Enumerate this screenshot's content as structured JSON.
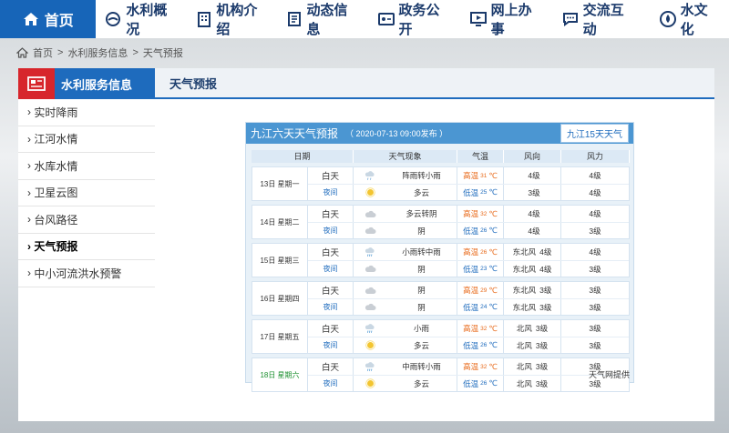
{
  "nav": {
    "home": "首页",
    "items": [
      "水利概况",
      "机构介绍",
      "动态信息",
      "政务公开",
      "网上办事",
      "交流互动",
      "水文化"
    ]
  },
  "breadcrumb": [
    "首页",
    ">",
    "水利服务信息",
    ">",
    "天气预报"
  ],
  "sidebar": {
    "title": "水利服务信息",
    "items": [
      "实时降雨",
      "江河水情",
      "水库水情",
      "卫星云图",
      "台风路径",
      "天气预报",
      "中小河流洪水预警"
    ],
    "active_index": 5
  },
  "content": {
    "tab": "天气预报"
  },
  "widget": {
    "title": "九江六天天气预报",
    "date": "（ 2020-07-13 09:00发布 ）",
    "button": "九江15天天气",
    "columns": [
      "日期",
      "天气现象",
      "气温",
      "风向",
      "风力"
    ],
    "days": [
      {
        "date": "13日 星期一",
        "day_desc": "阵雨转小雨",
        "day_hi_label": "高温",
        "day_temp": "31",
        "day_wind_dir": "",
        "day_wind_lvl": "4级",
        "day_force": "4级",
        "night_desc": "多云",
        "night_lo_label": "低温",
        "night_temp": "25",
        "night_wind_dir": "",
        "night_wind_lvl": "3级",
        "night_force": "4级",
        "day_icon": "shower",
        "night_icon": "sun"
      },
      {
        "date": "14日 星期二",
        "day_desc": "多云转阴",
        "day_hi_label": "高温",
        "day_temp": "32",
        "day_wind_dir": "",
        "day_wind_lvl": "4级",
        "day_force": "4级",
        "night_desc": "阴",
        "night_lo_label": "低温",
        "night_temp": "26",
        "night_wind_dir": "",
        "night_wind_lvl": "4级",
        "night_force": "3级",
        "day_icon": "cloud",
        "night_icon": "cloud"
      },
      {
        "date": "15日 星期三",
        "day_desc": "小雨转中雨",
        "day_hi_label": "高温",
        "day_temp": "26",
        "day_wind_dir": "东北风",
        "day_wind_lvl": "4级",
        "day_force": "4级",
        "night_desc": "阴",
        "night_lo_label": "低温",
        "night_temp": "23",
        "night_wind_dir": "东北风",
        "night_wind_lvl": "4级",
        "night_force": "3级",
        "day_icon": "rain",
        "night_icon": "cloud"
      },
      {
        "date": "16日 星期四",
        "day_desc": "阴",
        "day_hi_label": "高温",
        "day_temp": "29",
        "day_wind_dir": "东北风",
        "day_wind_lvl": "3级",
        "day_force": "3级",
        "night_desc": "阴",
        "night_lo_label": "低温",
        "night_temp": "24",
        "night_wind_dir": "东北风",
        "night_wind_lvl": "3级",
        "night_force": "3级",
        "day_icon": "cloud",
        "night_icon": "cloud"
      },
      {
        "date": "17日 星期五",
        "day_desc": "小雨",
        "day_hi_label": "高温",
        "day_temp": "32",
        "day_wind_dir": "北风",
        "day_wind_lvl": "3级",
        "day_force": "3级",
        "night_desc": "多云",
        "night_lo_label": "低温",
        "night_temp": "26",
        "night_wind_dir": "北风",
        "night_wind_lvl": "3级",
        "night_force": "3级",
        "day_icon": "rain",
        "night_icon": "sun"
      },
      {
        "date": "18日 星期六",
        "day_desc": "中雨转小雨",
        "day_hi_label": "高温",
        "day_temp": "32",
        "day_wind_dir": "北风",
        "day_wind_lvl": "3级",
        "day_force": "3级",
        "night_desc": "多云",
        "night_lo_label": "低温",
        "night_temp": "26",
        "night_wind_dir": "北风",
        "night_wind_lvl": "3级",
        "night_force": "3级",
        "day_icon": "rain",
        "night_icon": "sun",
        "weekend": true
      }
    ],
    "period_day": "白天",
    "period_night": "夜间",
    "unit": "℃",
    "source": "天气网提供"
  }
}
